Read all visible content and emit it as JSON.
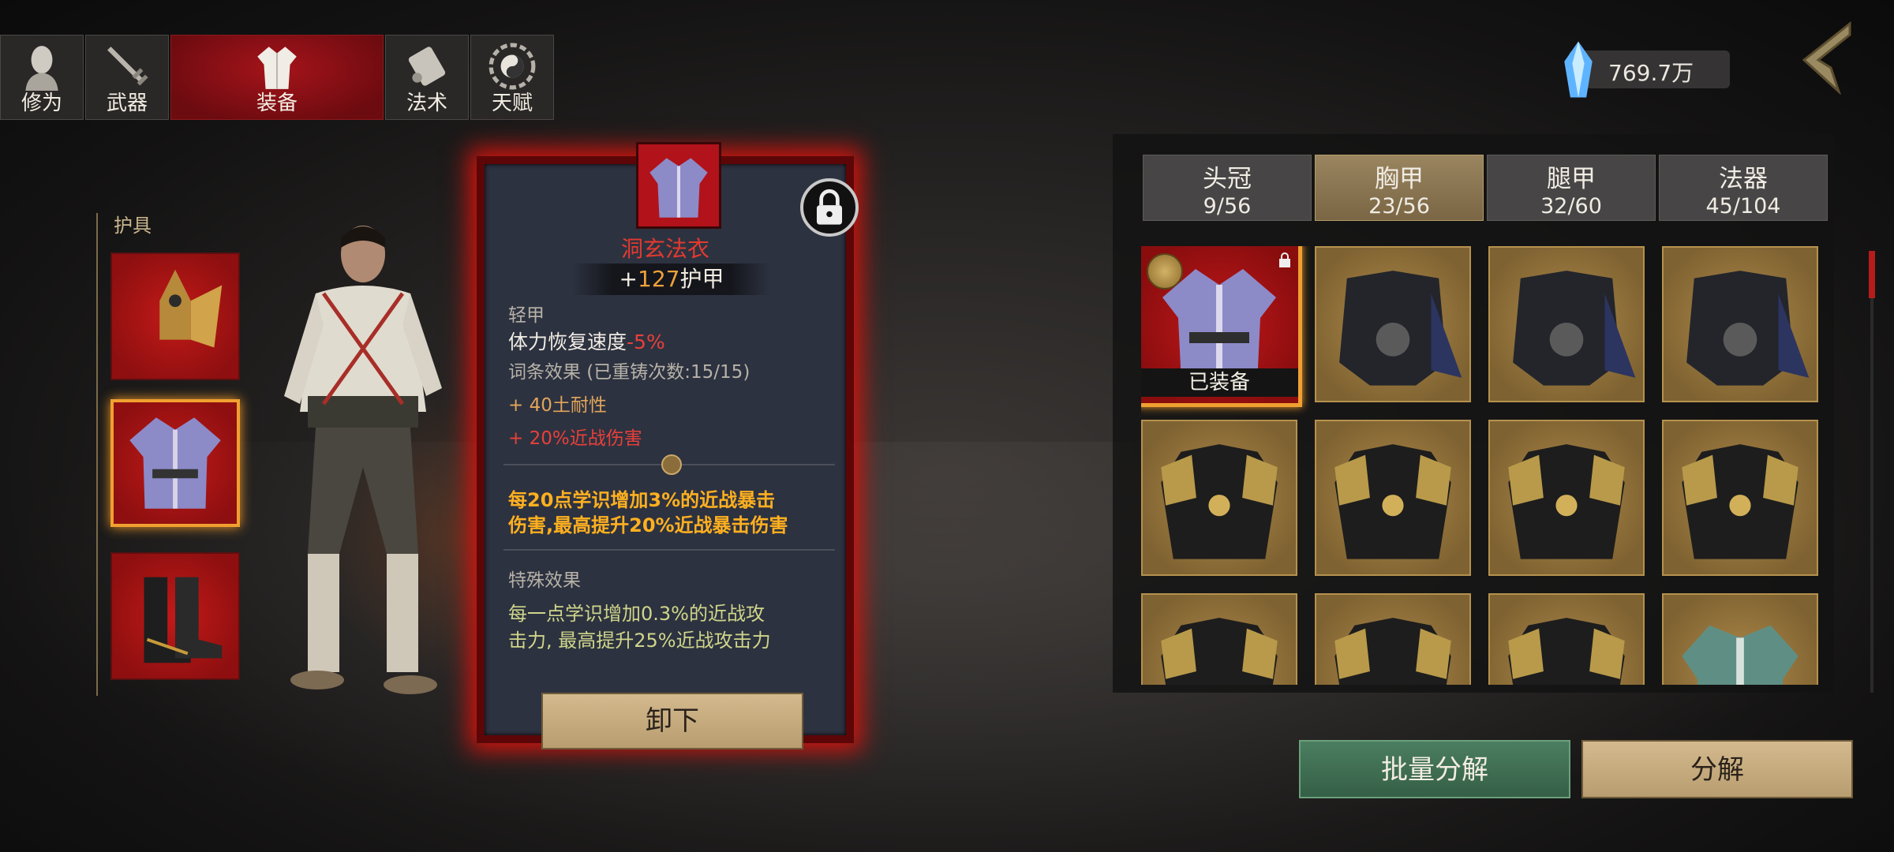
{
  "top_tabs": [
    {
      "label": "修为",
      "icon": "cultivation-icon"
    },
    {
      "label": "武器",
      "icon": "sword-icon"
    },
    {
      "label": "装备",
      "icon": "robe-icon",
      "active": true
    },
    {
      "label": "法术",
      "icon": "scroll-icon"
    },
    {
      "label": "天赋",
      "icon": "bagua-icon"
    }
  ],
  "currency": {
    "icon": "spirit-crystal-icon",
    "value": "769.7万"
  },
  "slot_panel": {
    "title": "护具"
  },
  "item_detail": {
    "name": "洞玄法衣",
    "armor_prefix": "+",
    "armor_value": "127",
    "armor_suffix": "护甲",
    "type": "轻甲",
    "stat_label": "体力恢复速度",
    "stat_value": "-5%",
    "affix_header": "词条效果  (已重铸次数:15/15)",
    "affix_1_prefix": "+ ",
    "affix_1_text": "40土耐性",
    "affix_2_prefix": "+ 20%",
    "affix_2_text": "近战伤害",
    "set_bonus_line1": "每20点学识增加3%的近战暴击",
    "set_bonus_line2": "伤害,最高提升20%近战暴击伤害",
    "special_header": "特殊效果",
    "special_line1": "每一点学识增加0.3%的近战攻",
    "special_line2": "击力, 最高提升25%近战攻击力",
    "unequip_label": "卸下"
  },
  "category_tabs": [
    {
      "label": "头冠",
      "count": "9/56"
    },
    {
      "label": "胸甲",
      "count": "23/56",
      "active": true
    },
    {
      "label": "腿甲",
      "count": "32/60"
    },
    {
      "label": "法器",
      "count": "45/104"
    }
  ],
  "inventory": {
    "equipped_label": "已装备"
  },
  "buttons": {
    "batch_decompose": "批量分解",
    "decompose": "分解"
  },
  "colors": {
    "accent_red": "#c21a18",
    "gold_frame": "#f0a030",
    "tan": "#b89d70",
    "green_button": "#3f6c52"
  }
}
